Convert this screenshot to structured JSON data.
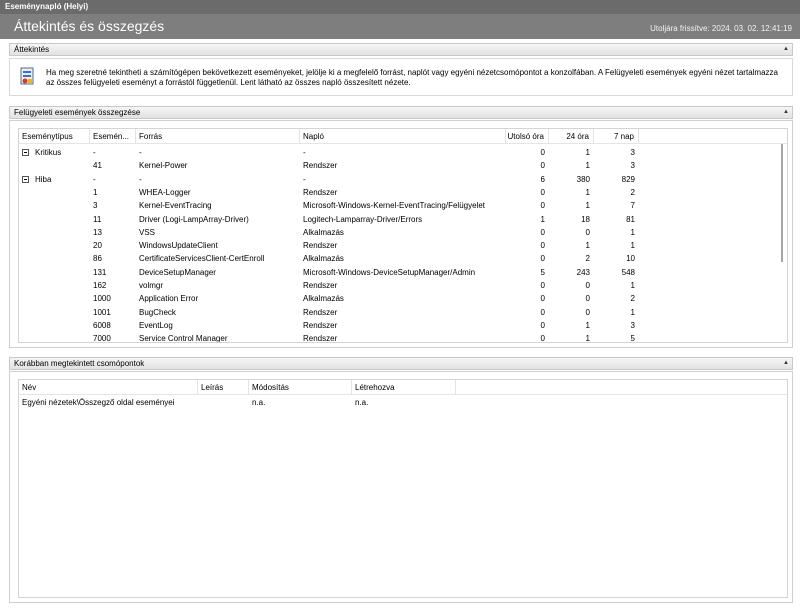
{
  "window": {
    "title": "Eseménynapló (Helyi)"
  },
  "header": {
    "title": "Áttekintés és összegzés",
    "updated": "Utoljára frissítve: 2024. 03. 02. 12:41:19"
  },
  "overview": {
    "section_label": "Áttekintés",
    "text": "Ha meg szeretné tekintheti a számítógépen bekövetkezett eseményeket, jelölje ki a megfelelő forrást, naplót vagy egyéni nézetcsomópontot a konzolfában. A Felügyeleti események egyéni nézet tartalmazza az összes felügyeleti eseményt a forrástól függetlenül. Lent látható az összes napló összesített nézete."
  },
  "admin_summary": {
    "section_label": "Felügyeleti események összegzése",
    "columns": [
      "Eseménytípus",
      "Esemén...",
      "Forrás",
      "Napló",
      "Utolsó óra",
      "24 óra",
      "7 nap"
    ],
    "rows": [
      [
        "Kritikus",
        "-",
        "-",
        "-",
        "0",
        "1",
        "3"
      ],
      [
        "",
        "41",
        "Kernel-Power",
        "Rendszer",
        "0",
        "1",
        "3"
      ],
      [
        "Hiba",
        "-",
        "-",
        "-",
        "6",
        "380",
        "829"
      ],
      [
        "",
        "1",
        "WHEA-Logger",
        "Rendszer",
        "0",
        "1",
        "2"
      ],
      [
        "",
        "3",
        "Kernel-EventTracing",
        "Microsoft-Windows-Kernel-EventTracing/Felügyelet",
        "0",
        "1",
        "7"
      ],
      [
        "",
        "11",
        "Driver (Logi-LampArray-Driver)",
        "Logitech-Lamparray-Driver/Errors",
        "1",
        "18",
        "81"
      ],
      [
        "",
        "13",
        "VSS",
        "Alkalmazás",
        "0",
        "0",
        "1"
      ],
      [
        "",
        "20",
        "WindowsUpdateClient",
        "Rendszer",
        "0",
        "1",
        "1"
      ],
      [
        "",
        "86",
        "CertificateServicesClient-CertEnroll",
        "Alkalmazás",
        "0",
        "2",
        "10"
      ],
      [
        "",
        "131",
        "DeviceSetupManager",
        "Microsoft-Windows-DeviceSetupManager/Admin",
        "5",
        "243",
        "548"
      ],
      [
        "",
        "162",
        "volmgr",
        "Rendszer",
        "0",
        "0",
        "1"
      ],
      [
        "",
        "1000",
        "Application Error",
        "Alkalmazás",
        "0",
        "0",
        "2"
      ],
      [
        "",
        "1001",
        "BugCheck",
        "Rendszer",
        "0",
        "0",
        "1"
      ],
      [
        "",
        "6008",
        "EventLog",
        "Rendszer",
        "0",
        "1",
        "3"
      ],
      [
        "",
        "7000",
        "Service Control Manager",
        "Rendszer",
        "0",
        "1",
        "5"
      ]
    ]
  },
  "recent_nodes": {
    "section_label": "Korábban megtekintett csomópontok",
    "columns": [
      "Név",
      "Leírás",
      "Módosítás",
      "Létrehozva"
    ],
    "rows": [
      [
        "Egyéni nézetek\\Összegző oldal eseményei",
        "",
        "n.a.",
        "n.a."
      ]
    ]
  },
  "icons": {
    "overview": "event-viewer-icon",
    "collapse": "collapse-arrow-icon",
    "expander": "minus-box-icon"
  },
  "colors": {
    "titlebar": "#6b6b6b",
    "header": "#7e7e7e",
    "section_bar": "#e8e8e8"
  }
}
